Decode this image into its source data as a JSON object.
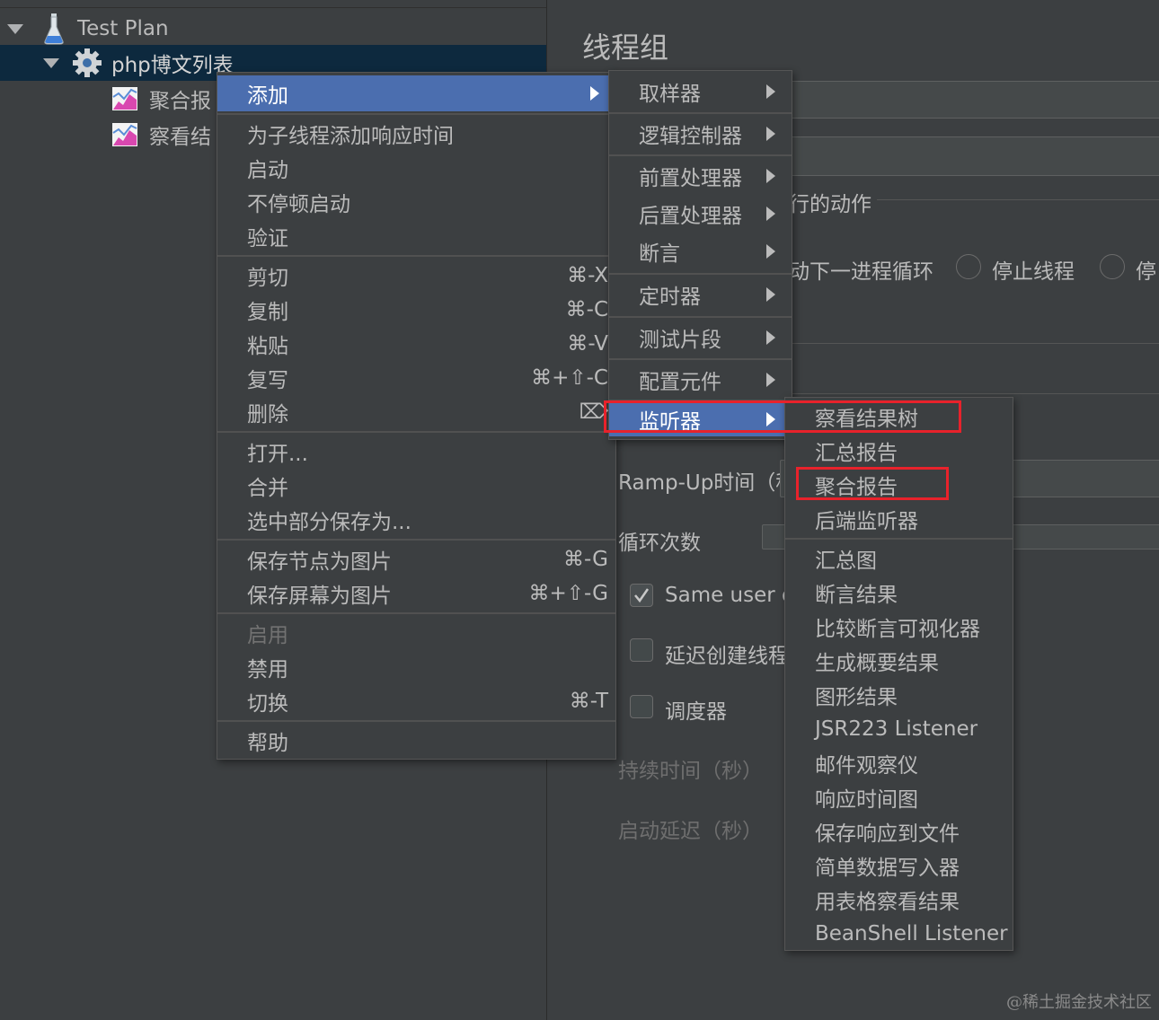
{
  "tree": {
    "root": "Test Plan",
    "thread_group": "php博文列表",
    "children": [
      "聚合报",
      "察看结"
    ]
  },
  "panel": {
    "title": "线程组",
    "action_label": "行的动作",
    "radio_next_loop": "动下一进程循环",
    "radio_stop_thread": "停止线程",
    "radio_stop_more": "停",
    "rampup": "Ramp-Up时间（秒）",
    "loop_count": "循环次数",
    "same_user": "Same user o",
    "delay_create": "延迟创建线程",
    "scheduler": "调度器",
    "duration": "持续时间（秒）",
    "startup_delay": "启动延迟（秒）"
  },
  "context_menu": {
    "items": [
      {
        "label": "添加"
      },
      {
        "label": "为子线程添加响应时间"
      },
      {
        "label": "启动"
      },
      {
        "label": "不停顿启动"
      },
      {
        "label": "验证"
      },
      {
        "label": "剪切",
        "shortcut": "⌘-X"
      },
      {
        "label": "复制",
        "shortcut": "⌘-C"
      },
      {
        "label": "粘贴",
        "shortcut": "⌘-V"
      },
      {
        "label": "复写",
        "shortcut": "⌘+⇧-C"
      },
      {
        "label": "删除",
        "shortcut": "⌦"
      },
      {
        "label": "打开..."
      },
      {
        "label": "合并"
      },
      {
        "label": "选中部分保存为..."
      },
      {
        "label": "保存节点为图片",
        "shortcut": "⌘-G"
      },
      {
        "label": "保存屏幕为图片",
        "shortcut": "⌘+⇧-G"
      },
      {
        "label": "启用"
      },
      {
        "label": "禁用"
      },
      {
        "label": "切换",
        "shortcut": "⌘-T"
      },
      {
        "label": "帮助"
      }
    ]
  },
  "add_submenu": {
    "items": [
      {
        "label": "取样器"
      },
      {
        "label": "逻辑控制器"
      },
      {
        "label": "前置处理器"
      },
      {
        "label": "后置处理器"
      },
      {
        "label": "断言"
      },
      {
        "label": "定时器"
      },
      {
        "label": "测试片段"
      },
      {
        "label": "配置元件"
      },
      {
        "label": "监听器"
      }
    ]
  },
  "listener_submenu": {
    "items": [
      {
        "label": "察看结果树"
      },
      {
        "label": "汇总报告"
      },
      {
        "label": "聚合报告"
      },
      {
        "label": "后端监听器"
      },
      {
        "label": "汇总图"
      },
      {
        "label": "断言结果"
      },
      {
        "label": "比较断言可视化器"
      },
      {
        "label": "生成概要结果"
      },
      {
        "label": "图形结果"
      },
      {
        "label": "JSR223 Listener"
      },
      {
        "label": "邮件观察仪"
      },
      {
        "label": "响应时间图"
      },
      {
        "label": "保存响应到文件"
      },
      {
        "label": "简单数据写入器"
      },
      {
        "label": "用表格察看结果"
      },
      {
        "label": "BeanShell Listener"
      }
    ]
  },
  "watermark": "@稀土掘金技术社区",
  "colors": {
    "highlight": "#4b6eaf",
    "annotation_red": "#e8222b",
    "background": "#3c3f41"
  }
}
